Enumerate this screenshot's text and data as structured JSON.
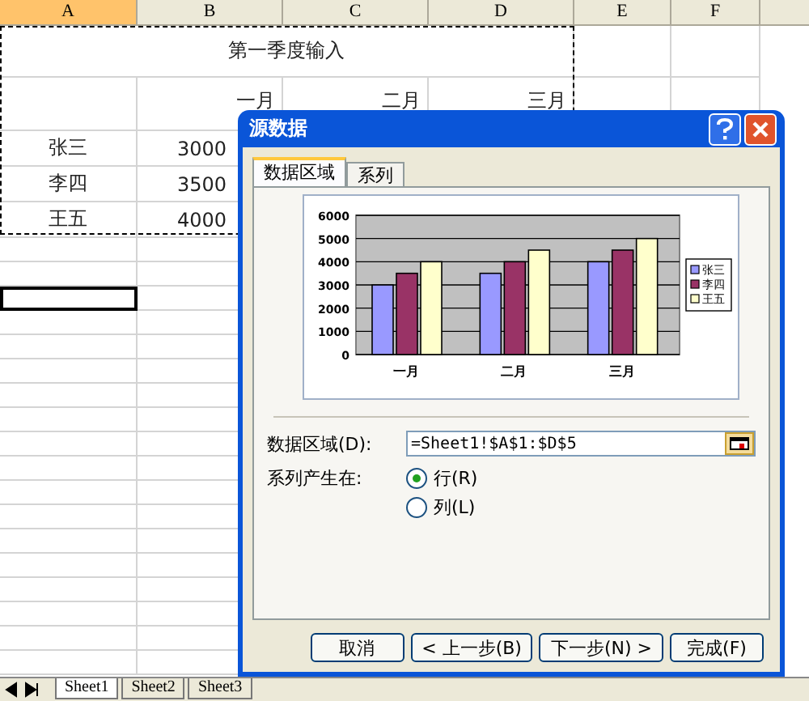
{
  "columns": [
    {
      "label": "A",
      "selected": true
    },
    {
      "label": "B",
      "selected": false
    },
    {
      "label": "C",
      "selected": false
    },
    {
      "label": "D",
      "selected": false
    },
    {
      "label": "E",
      "selected": false
    },
    {
      "label": "F",
      "selected": false
    }
  ],
  "sheet": {
    "title": "第一季度输入",
    "months": [
      "一月",
      "二月",
      "三月"
    ],
    "rows": [
      {
        "name": "张三",
        "value": "3000"
      },
      {
        "name": "李四",
        "value": "3500"
      },
      {
        "name": "王五",
        "value": "4000"
      }
    ]
  },
  "dialog": {
    "title": "源数据",
    "tabs": [
      {
        "label": "数据区域",
        "selected": true
      },
      {
        "label": "系列",
        "selected": false
      }
    ],
    "chart_data": {
      "type": "bar",
      "grid": true,
      "legend": true,
      "categories": [
        "一月",
        "二月",
        "三月"
      ],
      "yticks": [
        {
          "value": 0,
          "label": "0"
        },
        {
          "value": 1000,
          "label": "1000"
        },
        {
          "value": 2000,
          "label": "2000"
        },
        {
          "value": 3000,
          "label": "3000"
        },
        {
          "value": 4000,
          "label": "4000"
        },
        {
          "value": 5000,
          "label": "5000"
        },
        {
          "value": 6000,
          "label": "6000"
        }
      ],
      "ylim": [
        0,
        6000
      ],
      "series": [
        {
          "name": "张三",
          "color": "#9999ff",
          "values": [
            3000,
            3500,
            4000
          ]
        },
        {
          "name": "李四",
          "color": "#993366",
          "values": [
            3500,
            4000,
            4500
          ]
        },
        {
          "name": "王五",
          "color": "#ffffcc",
          "values": [
            4000,
            4500,
            5000
          ]
        }
      ]
    },
    "range_label": "数据区域(D):",
    "range_value": "=Sheet1!$A$1:$D$5",
    "series_in_label": "系列产生在:",
    "options": [
      {
        "label": "行(R)",
        "selected": true
      },
      {
        "label": "列(L)",
        "selected": false
      }
    ],
    "buttons": [
      "取消",
      "< 上一步(B)",
      "下一步(N) >",
      "完成(F)"
    ]
  },
  "sheet_tabs": [
    {
      "label": "Sheet1",
      "selected": true
    },
    {
      "label": "Sheet2",
      "selected": false
    },
    {
      "label": "Sheet3",
      "selected": false
    }
  ]
}
